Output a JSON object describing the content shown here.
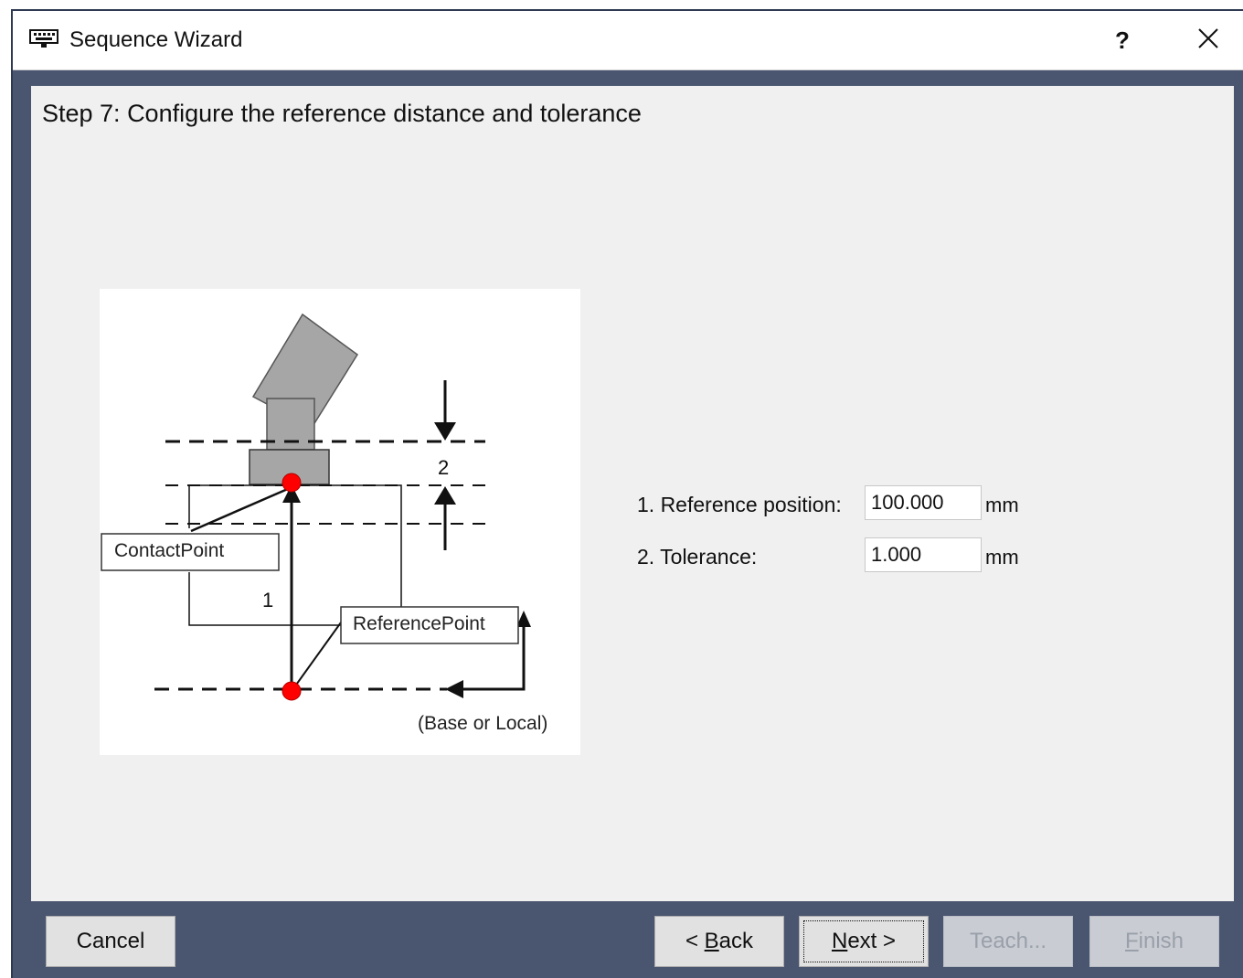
{
  "window": {
    "title": "Sequence Wizard",
    "help_label": "?",
    "icons": {
      "app": "terminal-icon",
      "close": "close-icon"
    }
  },
  "step": {
    "title": "Step 7: Configure the reference distance and tolerance"
  },
  "diagram": {
    "contact_point_label": "ContactPoint",
    "reference_point_label": "ReferencePoint",
    "dimension_1_label": "1",
    "dimension_2_label": "2",
    "base_label": "(Base or Local)"
  },
  "form": {
    "reference_position": {
      "label": "1. Reference position:",
      "value": "100.000",
      "unit": "mm"
    },
    "tolerance": {
      "label": "2. Tolerance:",
      "value": "1.000",
      "unit": "mm"
    }
  },
  "buttons": {
    "cancel": "Cancel",
    "back_prefix": "< ",
    "back_mnemonic": "B",
    "back_rest": "ack",
    "next_mnemonic": "N",
    "next_rest": "ext >",
    "teach": "Teach...",
    "finish_mnemonic": "F",
    "finish_rest": "inish"
  },
  "colors": {
    "frame": "#4a5570",
    "panel": "#f0f0f0",
    "point_marker": "#ff0000",
    "robot_part": "#a6a6a6"
  }
}
